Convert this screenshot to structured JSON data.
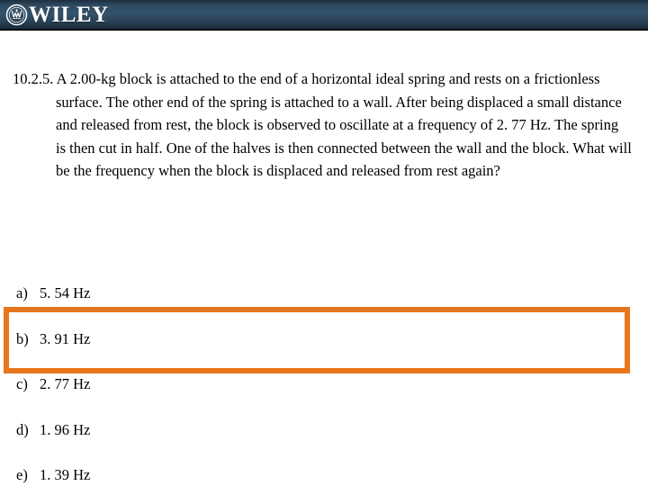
{
  "header": {
    "brand": "WILEY",
    "emblem_icon": "wiley-crest-icon",
    "background_color": "#2e4a60",
    "text_color": "#ffffff"
  },
  "question": {
    "number": "10.2.5.",
    "text": "10.2.5. A 2.00-kg block is attached to the end of a horizontal ideal spring and rests on a frictionless surface.  The other end of the spring is attached to a wall.  After being displaced a small distance and released from rest, the block is observed to oscillate at a frequency of 2. 77 Hz.  The spring is then cut in half.  One of the halves is then connected between the wall and the block.  What will be the frequency when the block is displaced and released from rest again?"
  },
  "options": [
    {
      "letter": "a)",
      "value": "5. 54 Hz",
      "highlighted": false
    },
    {
      "letter": "b)",
      "value": "3. 91 Hz",
      "highlighted": true
    },
    {
      "letter": "c)",
      "value": "2. 77 Hz",
      "highlighted": false
    },
    {
      "letter": "d)",
      "value": "1. 96 Hz",
      "highlighted": false
    },
    {
      "letter": "e)",
      "value": "1. 39 Hz",
      "highlighted": false
    }
  ],
  "highlight": {
    "color": "#e8761c",
    "target_option": "b)"
  }
}
